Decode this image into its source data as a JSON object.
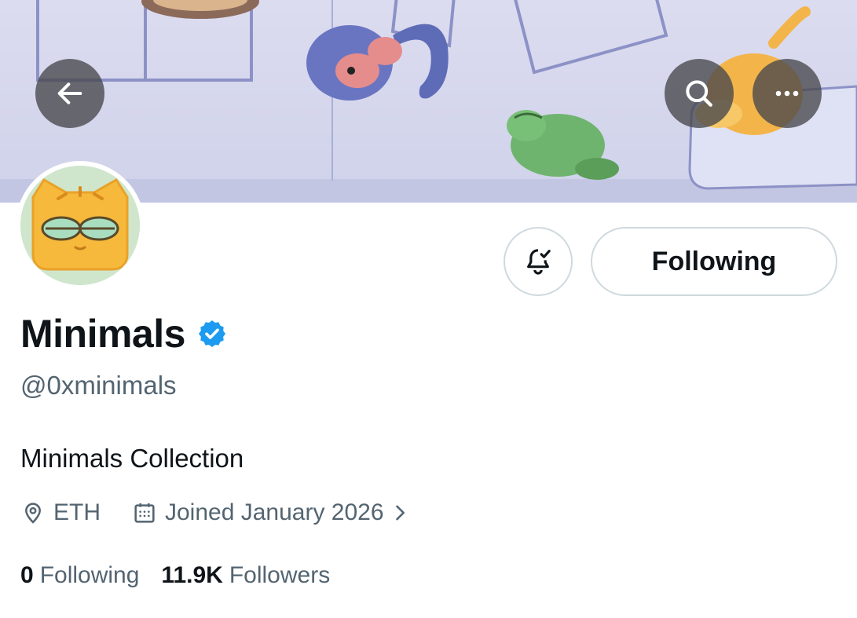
{
  "colors": {
    "accent_verified": "#1d9bf0",
    "text_primary": "#0f1419",
    "text_secondary": "#536471",
    "banner_background": "#d7d9ef",
    "avatar_background": "#cfe6cc"
  },
  "header": {
    "back_icon": "arrow-left-icon",
    "search_icon": "search-icon",
    "more_icon": "more-horizontal-icon"
  },
  "profile": {
    "name": "Minimals",
    "handle": "@0xminimals",
    "verified_icon": "verified-badge-icon",
    "bio": "Minimals Collection",
    "location": "ETH",
    "location_icon": "location-pin-icon",
    "joined": "Joined January 2026",
    "joined_icon": "calendar-icon",
    "joined_chevron_icon": "chevron-right-icon"
  },
  "actions": {
    "notification_icon": "bell-check-icon",
    "follow_label": "Following"
  },
  "stats": {
    "following_count": "0",
    "following_label": "Following",
    "followers_count": "11.9K",
    "followers_label": "Followers"
  }
}
